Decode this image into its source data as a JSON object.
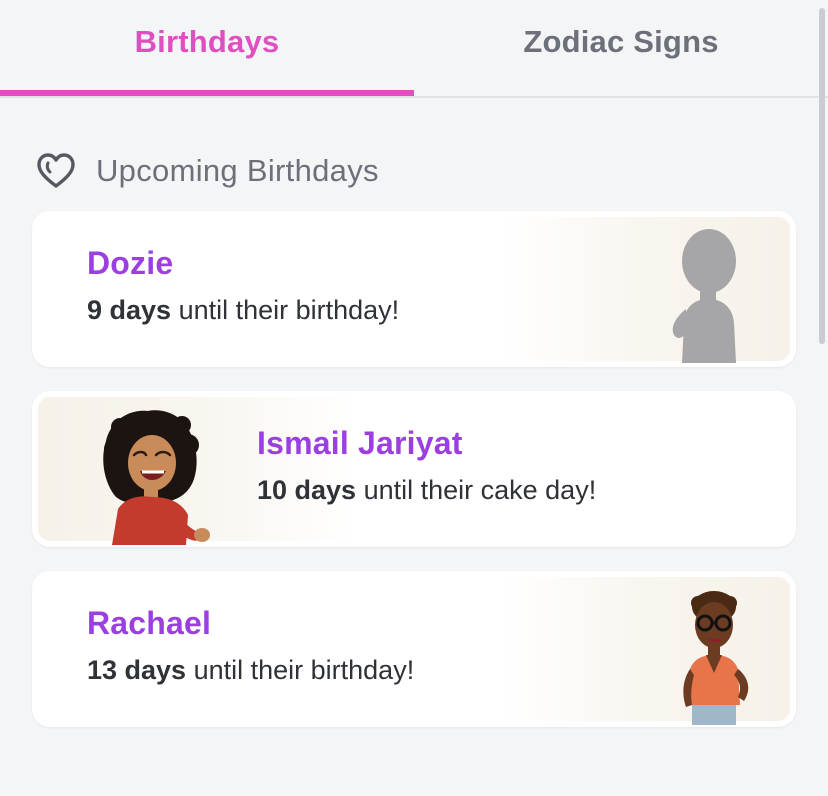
{
  "tabs": [
    {
      "label": "Birthdays",
      "active": true
    },
    {
      "label": "Zodiac Signs",
      "active": false
    }
  ],
  "section": {
    "icon": "heart-outline-icon",
    "title": "Upcoming Birthdays"
  },
  "cards": [
    {
      "name": "Dozie",
      "days": "9 days",
      "suffix": " until their birthday!",
      "avatar": "silhouette-avatar"
    },
    {
      "name": "Ismail Jariyat",
      "days": "10 days",
      "suffix": " until their cake day!",
      "avatar": "bitmoji-laughing-avatar"
    },
    {
      "name": "Rachael",
      "days": "13 days",
      "suffix": " until their birthday!",
      "avatar": "bitmoji-glasses-avatar"
    }
  ],
  "colors": {
    "accent": "#e04fc0",
    "name": "#9b3fe0",
    "muted": "#6c7179",
    "background": "#f4f5f7"
  }
}
